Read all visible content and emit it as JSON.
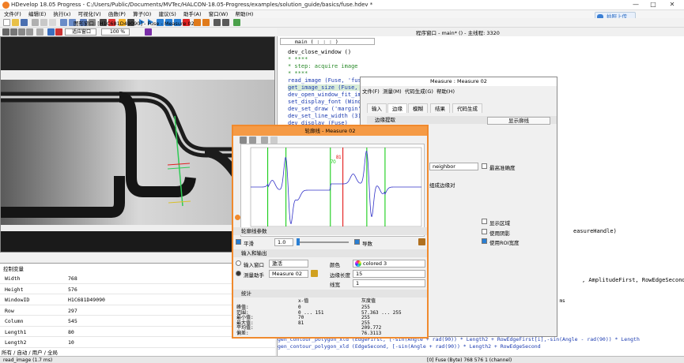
{
  "window": {
    "title": "HDevelop 18.05 Progress - C:/Users/Public/Documents/MVTec/HALCON-18.05-Progress/examples/solution_guide/basics/fuse.hdev *",
    "min": "—",
    "max": "□",
    "close": "✕"
  },
  "menu": [
    "文件(F)",
    "编辑(E)",
    "执行(x)",
    "可视化(V)",
    "函数(P)",
    "算子(O)",
    "建议(S)",
    "助手(A)",
    "窗口(W)",
    "帮助(H)"
  ],
  "upload": "拍照上传",
  "graphics": {
    "title": "图形窗口: [H1C681D49090] - Fuse - Measure 02",
    "zoom": "100 %",
    "fit": "适应窗口"
  },
  "program": {
    "window_title": "程序窗口 - main* () - 主线程: 3320",
    "proc_select": "main ( : : : )"
  },
  "code_lines": [
    "dev_close_window ()",
    "* ****",
    "* step: acquire image",
    "* ****",
    "read_image (Fuse, 'fuse",
    "get_image_size (Fuse, W",
    "dev_open_window_fit_ima",
    "set_display_font (Window",
    "dev_set_draw ('margin')",
    "dev_set_line_width (3)",
    "dev_display (Fuse)"
  ],
  "code_tail": [
    "      gen_contour_polygon_xld (EdgeFirst, [-sin(Angle + rad(90)) * Length2 + RowEdgeFirst[i],-sin(Angle - rad(90)) * Length",
    "      gen_contour_polygon_xld (EdgeSecond, [-sin(Angle + rad(90)) * Length2 + RowEdgeSecond"
  ],
  "code_frag": {
    "a": "easureHandle)",
    "b": ", AmplitudeFirst, RowEdgeSecond",
    "c": "1.7 ms"
  },
  "variables": {
    "title": "控制变量",
    "rows": [
      {
        "k": "Width",
        "v": "768"
      },
      {
        "k": "Height",
        "v": "576"
      },
      {
        "k": "WindowID",
        "v": "H1C681D49090"
      },
      {
        "k": "Row",
        "v": "297"
      },
      {
        "k": "Column",
        "v": "545"
      },
      {
        "k": "Length1",
        "v": "80"
      },
      {
        "k": "Length2",
        "v": "10"
      }
    ],
    "tabs": [
      "所有",
      "自动",
      "用户",
      "全局"
    ]
  },
  "status": {
    "left": "read_image (1.7 ms)",
    "right": "[0] Fuse (Byte) 768 576 1 (channel)"
  },
  "measure": {
    "title": "Measure : Measure 02",
    "menu": [
      "文件(F)",
      "测量(M)",
      "代码生成(G)",
      "帮助(H)"
    ],
    "tabs": [
      "输入",
      "边缘",
      "模糊",
      "结果",
      "代码生成"
    ],
    "section_edge": "边缘提取",
    "show_profile": "显示廓线",
    "interp": "neighbor",
    "max_ampl": "最高准确度",
    "pair": "组成边缘对",
    "show_region": "显示区域",
    "use_shadow": "使用阴影",
    "use_roi_width": "使用ROI宽度"
  },
  "profile": {
    "title": "轮廓线 - Measure 02",
    "params_section": "轮廓线参数",
    "smooth_label": "平滑",
    "smooth_value": "1.0",
    "derivative_label": "导数",
    "io_section": "输入和输出",
    "input_window_label": "输入窗口",
    "input_window_value": "激活",
    "assistant_label": "测量助手",
    "assistant_value": "Measure 02",
    "color_label": "颜色",
    "color_value": "colored 3",
    "edge_len_label": "边缘长度",
    "edge_len_value": "15",
    "line_width_label": "线宽",
    "line_width_value": "1",
    "stats_section": "统计",
    "marker_a": "81",
    "marker_b": "70",
    "stats": {
      "labels": [
        "峰值:",
        "范围:",
        "最小值:",
        "最大值:",
        "平均值:",
        "偏差:"
      ],
      "x_header": "x-值",
      "x_vals": [
        "0",
        "0 ... 151",
        "70",
        "81",
        "",
        ""
      ],
      "g_header": "灰度值",
      "g_vals": [
        "255",
        "57.363 ... 255",
        "255",
        "255",
        "209.772",
        "76.3113"
      ]
    }
  },
  "chart_data": {
    "type": "line",
    "xlim": [
      0,
      150
    ],
    "ylim": [
      -1,
      1
    ],
    "x_ticks": [
      0,
      20,
      40,
      60,
      80,
      100,
      120,
      140,
      150
    ],
    "green_lines": [
      15,
      31,
      70,
      102,
      118
    ],
    "red_line": 81
  },
  "colors": {
    "accent": "#f08a2e",
    "green": "#00c800",
    "red": "#e00000",
    "curve": "#3232c8"
  }
}
